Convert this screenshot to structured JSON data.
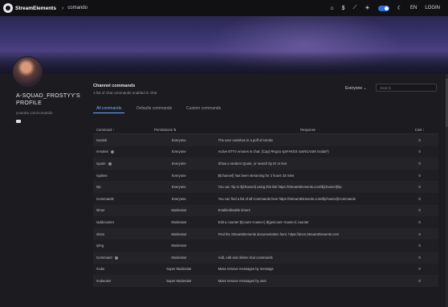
{
  "header": {
    "brand": "StreamElements",
    "breadcrumb_sep": "›",
    "breadcrumb": "comando",
    "lang": "EN",
    "login": "LOGIN",
    "icons": [
      "home-icon",
      "dollar-icon",
      "wand-icon",
      "sun-icon",
      "moon-icon"
    ]
  },
  "profile": {
    "name": "A-SQUAD_FROSTYY'S PROFILE",
    "link": "youtube.com/comando"
  },
  "section": {
    "title": "Channel commands",
    "subtitle": "A list of chat commands enabled in chat",
    "filter": "Everyone ⌄",
    "search_placeholder": "Search"
  },
  "tabs": [
    "All commands",
    "Defaults commands",
    "Custom commands"
  ],
  "table": {
    "headers": {
      "command": "Command ↑",
      "permissions": "Permissions ⇅",
      "response": "Response",
      "cost": "Cost ↑"
    },
    "rows": [
      {
        "command": "!vanish",
        "info": false,
        "permission": "Everyone",
        "response": "The user vanishes in a puff of smoke",
        "cost": "0"
      },
      {
        "command": "!emotes",
        "info": true,
        "permission": "Everyone",
        "response": "Active BTTV emotes in chat: (Cap) RKgoo sprFAKES sosNGASM roodat*)",
        "cost": "0"
      },
      {
        "command": "!quote",
        "info": true,
        "permission": "Everyone",
        "response": "Show a random Quote, or search by ID or text",
        "cost": "0"
      },
      {
        "command": "!uptime",
        "info": false,
        "permission": "Everyone",
        "response": "${channel} has been streaming for 2 hours 33 mins",
        "cost": "0"
      },
      {
        "command": "!tip",
        "info": false,
        "permission": "Everyone",
        "response": "You can Tip to ${channel} using this link https://StreamElements.com/${channel}/tip",
        "cost": "0"
      },
      {
        "command": "!commands",
        "info": false,
        "permission": "Everyone",
        "response": "You can find a list of all Commands here https://StreamElements.com/${channel}/commands",
        "cost": "0"
      },
      {
        "command": "!timer",
        "info": false,
        "permission": "Moderator",
        "response": "Enable/disable timers",
        "cost": "0"
      },
      {
        "command": "!addcounter",
        "info": false,
        "permission": "Moderator",
        "response": "Edit a counter ${count <name>} ${getcount <name>} counter",
        "cost": "0"
      },
      {
        "command": "!docs",
        "info": false,
        "permission": "Moderator",
        "response": "Find the StreamElements documentation here: https://docs.StreamElements.com",
        "cost": "0"
      },
      {
        "command": "!ping",
        "info": false,
        "permission": "Moderator",
        "response": "",
        "cost": "0"
      },
      {
        "command": "!command",
        "info": true,
        "permission": "Moderator",
        "response": "Add, edit and delete chat commands",
        "cost": "0"
      },
      {
        "command": "!nuke",
        "info": false,
        "permission": "Super Moderator",
        "response": "Mass remove messages by message",
        "cost": "0"
      },
      {
        "command": "!nukeuser",
        "info": false,
        "permission": "Super Moderator",
        "response": "Mass remove messages by user",
        "cost": "0"
      }
    ]
  }
}
